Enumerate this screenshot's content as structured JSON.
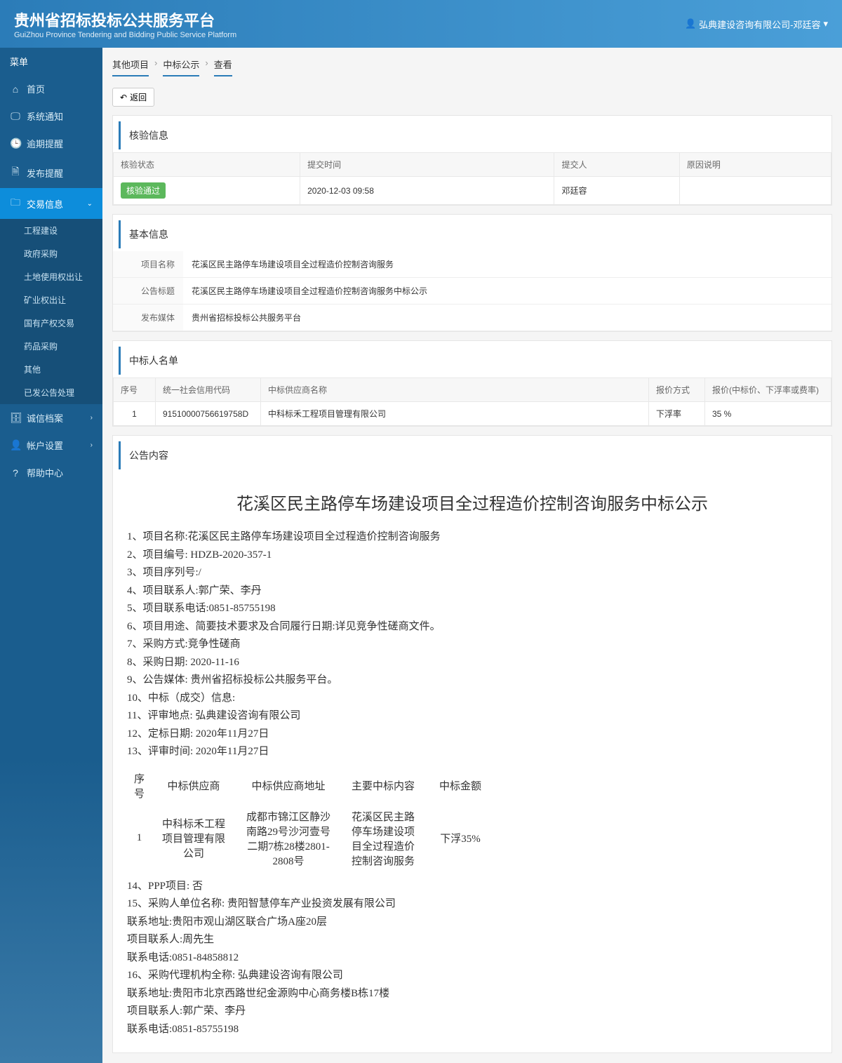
{
  "header": {
    "title_cn": "贵州省招标投标公共服务平台",
    "title_en": "GuiZhou Province Tendering and Bidding Public Service Platform",
    "user": "弘典建设咨询有限公司-邓廷容"
  },
  "sidebar": {
    "menu_label": "菜单",
    "items": [
      {
        "icon": "home",
        "label": "首页"
      },
      {
        "icon": "monitor",
        "label": "系统通知"
      },
      {
        "icon": "clock",
        "label": "逾期提醒"
      },
      {
        "icon": "doc",
        "label": "发布提醒"
      },
      {
        "icon": "folder",
        "label": "交易信息",
        "active": true,
        "children": [
          "工程建设",
          "政府采购",
          "土地使用权出让",
          "矿业权出让",
          "国有产权交易",
          "药品采购",
          "其他",
          "已发公告处理"
        ]
      },
      {
        "icon": "card",
        "label": "诚信档案",
        "arrow": true
      },
      {
        "icon": "person",
        "label": "帐户设置",
        "arrow": true
      },
      {
        "icon": "help",
        "label": "帮助中心"
      }
    ]
  },
  "breadcrumb": [
    "其他项目",
    "中标公示",
    "查看"
  ],
  "back_btn": "返回",
  "verify": {
    "title": "核验信息",
    "headers": [
      "核验状态",
      "提交时间",
      "提交人",
      "原因说明"
    ],
    "status_badge": "核验通过",
    "time": "2020-12-03 09:58",
    "submitter": "邓廷容",
    "reason": ""
  },
  "basic": {
    "title": "基本信息",
    "rows": [
      {
        "label": "项目名称",
        "value": "花溪区民主路停车场建设项目全过程造价控制咨询服务"
      },
      {
        "label": "公告标题",
        "value": "花溪区民主路停车场建设项目全过程造价控制咨询服务中标公示"
      },
      {
        "label": "发布媒体",
        "value": "贵州省招标投标公共服务平台"
      }
    ]
  },
  "winners": {
    "title": "中标人名单",
    "headers": [
      "序号",
      "统一社会信用代码",
      "中标供应商名称",
      "报价方式",
      "报价(中标价、下浮率或费率)"
    ],
    "rows": [
      {
        "idx": "1",
        "code": "91510000756619758D",
        "name": "中科标禾工程项目管理有限公司",
        "method": "下浮率",
        "price": "35 %"
      }
    ]
  },
  "notice": {
    "title": "公告内容",
    "heading": "花溪区民主路停车场建设项目全过程造价控制咨询服务中标公示",
    "lines": [
      "1、项目名称:花溪区民主路停车场建设项目全过程造价控制咨询服务",
      "2、项目编号: HDZB-2020-357-1",
      "3、项目序列号:/",
      "4、项目联系人:郭广荣、李丹",
      "5、项目联系电话:0851-85755198",
      "6、项目用途、简要技术要求及合同履行日期:详见竞争性磋商文件。",
      "7、采购方式:竞争性磋商",
      "8、采购日期: 2020-11-16",
      "9、公告媒体: 贵州省招标投标公共服务平台。",
      "10、中标（成交）信息:",
      "11、评审地点: 弘典建设咨询有限公司",
      "12、定标日期:  2020年11月27日",
      "13、评审时间: 2020年11月27日"
    ],
    "table": {
      "headers": [
        "序号",
        "中标供应商",
        "中标供应商地址",
        "主要中标内容",
        "中标金额"
      ],
      "row": {
        "idx": "1",
        "supplier": "中科标禾工程项目管理有限公司",
        "addr": "成都市锦江区静沙南路29号沙河壹号二期7栋28楼2801-2808号",
        "content": "花溪区民主路停车场建设项目全过程造价控制咨询服务",
        "amount": "下浮35%"
      }
    },
    "lines2": [
      "14、PPP项目: 否",
      "15、采购人单位名称: 贵阳智慧停车产业投资发展有限公司",
      "联系地址:贵阳市观山湖区联合广场A座20层",
      "项目联系人:周先生",
      "联系电话:0851-84858812",
      "16、采购代理机构全称: 弘典建设咨询有限公司",
      "联系地址:贵阳市北京西路世纪金源购中心商务楼B栋17楼",
      "项目联系人:郭广荣、李丹",
      "联系电话:0851-85755198"
    ]
  }
}
